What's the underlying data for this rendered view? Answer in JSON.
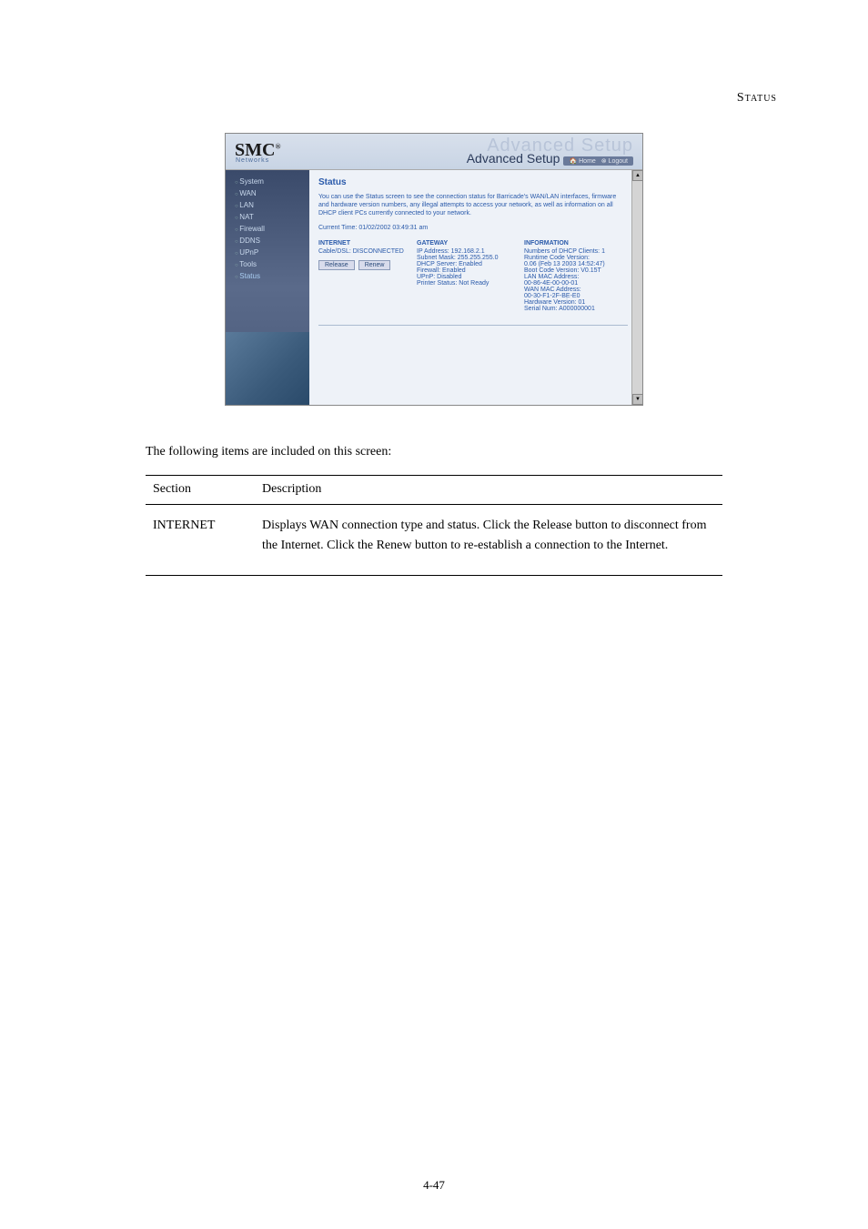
{
  "section_header": "Status",
  "page_number": "4-47",
  "screenshot": {
    "logo": "SMC",
    "logo_sub": "Networks",
    "title_bg": "Advanced Setup",
    "title": "Advanced Setup",
    "top_links": {
      "home": "Home",
      "logout": "Logout"
    },
    "sidebar": {
      "items": [
        {
          "label": "System"
        },
        {
          "label": "WAN"
        },
        {
          "label": "LAN"
        },
        {
          "label": "NAT"
        },
        {
          "label": "Firewall"
        },
        {
          "label": "DDNS"
        },
        {
          "label": "UPnP"
        },
        {
          "label": "Tools"
        },
        {
          "label": "Status"
        }
      ]
    },
    "content": {
      "title": "Status",
      "desc": "You can use the Status screen to see the connection status for Barricade's WAN/LAN interfaces, firmware and hardware version numbers, any illegal attempts to access your network, as well as information on all DHCP client PCs currently connected to your network.",
      "time": "Current Time: 01/02/2002 03:49:31 am",
      "internet": {
        "title": "INTERNET",
        "status": "Cable/DSL: DISCONNECTED",
        "release_btn": "Release",
        "renew_btn": "Renew"
      },
      "gateway": {
        "title": "GATEWAY",
        "lines": [
          "IP Address: 192.168.2.1",
          "Subnet Mask: 255.255.255.0",
          "DHCP Server: Enabled",
          "Firewall: Enabled",
          "UPnP: Disabled",
          "Printer Status: Not Ready"
        ]
      },
      "info": {
        "title": "INFORMATION",
        "lines": [
          "Numbers of DHCP Clients: 1",
          "Runtime Code Version:",
          "  0.06 (Feb 13 2003 14:52:47)",
          "Boot Code Version: V0.15T",
          "LAN MAC Address:",
          "  00-86-4E-00-00-01",
          "WAN MAC Address:",
          "  00-30-F1-2F-BE-E0",
          "Hardware Version: 01",
          "Serial Num: A000000001"
        ]
      }
    }
  },
  "body": {
    "p1": "The following items are included on this screen:",
    "table_header": {
      "c1": "Section",
      "c2": "Description"
    },
    "row1": {
      "c1": "INTERNET",
      "c2": "Displays WAN connection type and status. Click the Release button to disconnect from the Internet. Click the Renew button to re-establish a connection to the Internet."
    }
  }
}
